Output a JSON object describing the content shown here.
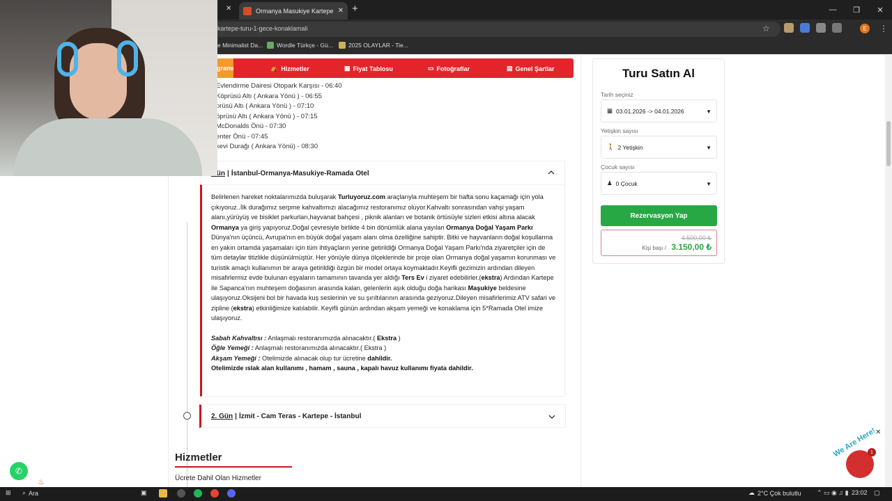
{
  "browser": {
    "tab_title": "Ormanya Masukiye Kartepe Tur",
    "url": "kartepe-turu-1-gece-konaklamali",
    "bookmarks": [
      "e Minimalist Da...",
      "Wordle Türkçe - Gü...",
      "2025 OLAYLAR - Tie..."
    ],
    "profile_initial": "E"
  },
  "nav": {
    "program": "gramı",
    "hizmetler": "Hizmetler",
    "fiyat": "Fiyat Tablosu",
    "foto": "Fotoğraflar",
    "sartlar": "Genel Şartlar"
  },
  "stops": [
    "Evlendirme Dairesi Otopark Karşısı - 06:40",
    "Köprüsü Altı ( Ankara Yönü ) - 06:55",
    "prüsü Altı ( Ankara Yönü ) - 07:10",
    "öprüsü Altı ( Ankara Yönü ) - 07:15",
    "McDonalds Önü - 07:30",
    "enter Önü - 07:45",
    "kevi Durağı ( Ankara Yönü) - 08:30"
  ],
  "day1": {
    "num": "Gün",
    "title": "İstanbul-Ormanya-Masukiye-Ramada Otel"
  },
  "day1_body": {
    "p1": "Belirlenen hareket noktalarımızda buluşarak",
    "brand": "Turluyoruz.com",
    "p2": "araçlarıyla muhteşem bir hafta sonu kaçamağı için yola çıkıyoruz..İlk durağımız  serpme kahvaltımızı alacağımız restoranımız oluyor.Kahvaltı sonrasından vahşi yaşam alanı,yürüyüş ve bisiklet parkurları,hayvanat bahçesi , piknik alanları ve botanik örtüsüyle sizleri etkisi altına alacak",
    "ormanya": "Ormanya",
    "p3": "ya giriş yapıyoruz.Doğal çevresiyle birlikte 4 bin dönümlük alana yayılan",
    "ormanya_park": "Ormanya Doğal Yaşam Parkı",
    "p4": "Dünya'nın üçüncü, Avrupa'nın en büyük doğal yaşam alanı olma özelliğine sahiptir. Bitki ve hayvanların doğal koşullarına en yakın ortamda yaşamaları için tüm ihtiyaçların yerine getirildiği Ormanya Doğal Yaşam Parkı'nda ziyaretçiler için de tüm detaylar titizlikle düşünülmüştür. Her yönüyle dünya ölçeklerinde bir proje olan Ormanya doğal yaşamın korunması ve turistik amaçlı kullanımın bir araya getirildiği özgün bir model ortaya koymaktadır.Keyifli gezimizin ardından dileyen misafirlermiz  evde bulunan eşyaların tamamının tavanda yer aldığı",
    "ters_ev": "Ters Ev",
    "p5": "i ziyaret edebilirler.(",
    "ekstra1": "ekstra",
    "p6": ") Ardından Kartepe ile Sapanca'nın muhteşem doğasının arasında kalan, gelenlerin aşık olduğu doğa harikası",
    "masukiye": "Maşukiye",
    "p7": "beldesine ulaşıyoruz.Oksijeni bol bir havada kuş seslerinin ve su şırıltılarının arasında geziyoruz.Dileyen misafirlerimiz ATV safari ve zipline (",
    "ekstra2": "ekstra",
    "p8": ") etkinliğimize katılabilir. Keyifli günün ardından akşam yemeği ve konaklama için 5*Ramada Otel imize ulaşıyoruz.",
    "kahvalti_l": "Sabah Kahvaltısı :",
    "kahvalti_t": "Anlaşmalı restoranımızda alınacaktır.(",
    "kahvalti_e": "Ekstra",
    "kahvalti_end": ")",
    "ogle_l": "Öğle Yemeği :",
    "ogle_t": "Anlaşmalı restoranımızda alınacaktır.( Ekstra )",
    "aksam_l": "Akşam Yemeği :",
    "aksam_t": "Otelimizde alınacak olup tur ücretine",
    "aksam_d": "dahildir.",
    "otel": "Otelimizde ıslak alan kullanımı , hamam , sauna , kapalı havuz kullanımı fiyata dahildir."
  },
  "day2": {
    "num": "2. Gün",
    "title": "İzmit - Cam Teras - Kartepe - İstanbul"
  },
  "services": {
    "heading": "Hizmetler",
    "included": "Ücrete Dahil Olan Hizmetler"
  },
  "buy": {
    "title": "Turu Satın Al",
    "date_label": "Tarih seçiniz",
    "date_value": "03.01.2026 -> 04.01.2026",
    "adult_label": "Yetişkin sayısı",
    "adult_value": "2 Yetişkin",
    "child_label": "Çocuk sayısı",
    "child_value": "0 Çocuk",
    "reserve": "Rezervasyon Yap",
    "old_price": "4.500,00 ₺",
    "per_person": "Kişi başı /",
    "price": "3.150,00 ₺"
  },
  "widgets": {
    "we_are_here": "We Are Here!",
    "chat_badge": "1"
  },
  "taskbar": {
    "search": "Ara",
    "weather": "2°C  Çok bulutlu",
    "time": "23:02"
  },
  "colors": {
    "brand_red": "#e3242b",
    "active_orange": "#f29a2e",
    "green": "#28a745"
  }
}
